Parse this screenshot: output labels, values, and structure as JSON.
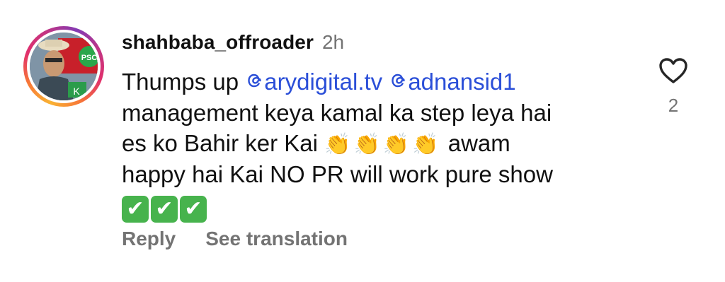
{
  "comment": {
    "username": "shahbaba_offroader",
    "time": "2h",
    "text": {
      "l1_prefix": "Thumps up ",
      "mention1": "arydigital.tv",
      "mention2": "adnansid1",
      "l2": "management keya kamal ka step leya hai",
      "l3_prefix": "es ko Bahir ker Kai ",
      "clap": "👏",
      "l3_suffix": " awam",
      "l4": "happy hai Kai NO PR will work pure show",
      "check": "✔"
    },
    "like_count": "2",
    "actions": {
      "reply": "Reply",
      "see_translation": "See translation"
    }
  },
  "avatar_badge": {
    "text": "PSC"
  },
  "icons": {
    "like": "heart-icon",
    "mention": "threads-at-icon"
  },
  "colors": {
    "mention": "#2b4fd8",
    "meta": "#737373",
    "check_bg": "#47b34d"
  }
}
